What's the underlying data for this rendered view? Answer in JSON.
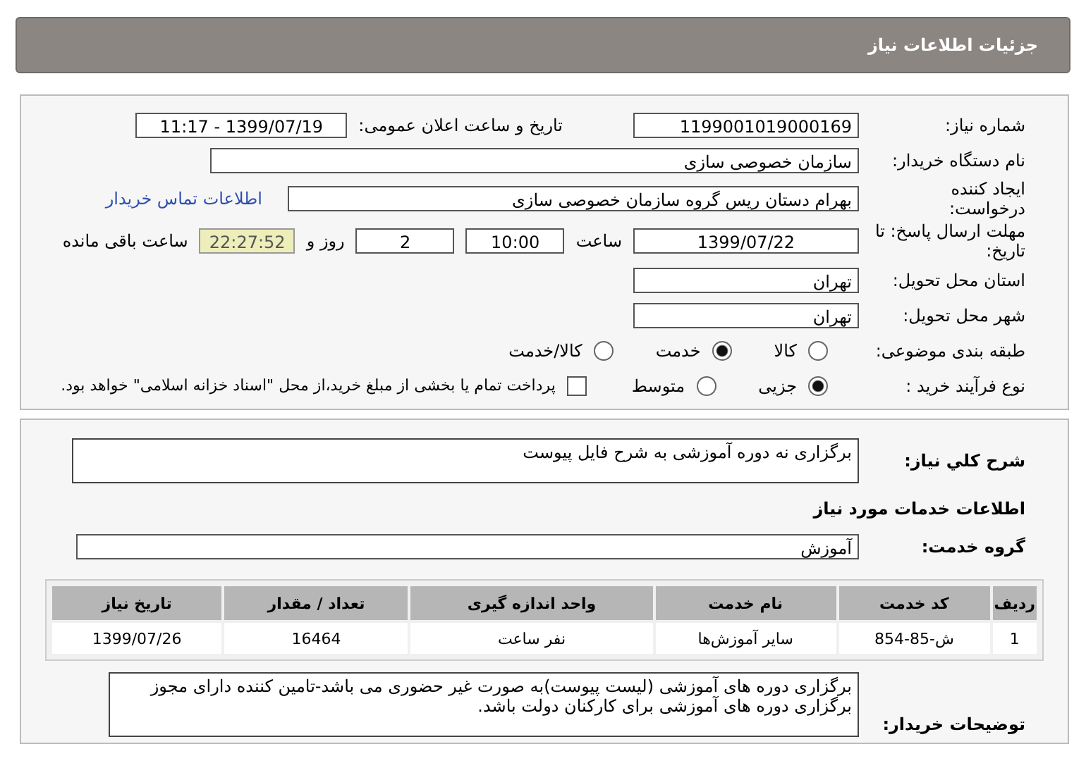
{
  "header": {
    "title": "جزئیات اطلاعات نیاز"
  },
  "need_number": {
    "label": "شماره نیاز:",
    "value": "1199001019000169"
  },
  "announce": {
    "label": "تاریخ و ساعت اعلان عمومی:",
    "value": "1399/07/19 - 11:17"
  },
  "buyer_org": {
    "label": "نام دستگاه خریدار:",
    "value": "سازمان خصوصی سازی"
  },
  "creator": {
    "label": "ایجاد کننده درخواست:",
    "value": "بهرام دستان ریس گروه سازمان خصوصی سازی",
    "link": "اطلاعات تماس خریدار"
  },
  "deadline": {
    "label": "مهلت ارسال پاسخ: تا تاریخ:",
    "date": "1399/07/22",
    "time_label": "ساعت",
    "time": "10:00",
    "days": "2",
    "days_label": "روز و",
    "remaining": "22:27:52",
    "remaining_label": "ساعت باقی مانده"
  },
  "province": {
    "label": "استان محل تحویل:",
    "value": "تهران"
  },
  "city": {
    "label": "شهر محل تحویل:",
    "value": "تهران"
  },
  "category": {
    "label": "طبقه بندی موضوعی:",
    "options": [
      {
        "label": "کالا",
        "selected": false
      },
      {
        "label": "خدمت",
        "selected": true
      },
      {
        "label": "کالا/خدمت",
        "selected": false
      }
    ]
  },
  "process": {
    "label": "نوع فرآیند خرید :",
    "options": [
      {
        "label": "جزیی",
        "selected": true
      },
      {
        "label": "متوسط",
        "selected": false
      }
    ],
    "payment": {
      "label": "پرداخت تمام یا بخشی از مبلغ خرید،از محل \"اسناد خزانه اسلامی\" خواهد بود.",
      "checked": false
    }
  },
  "summary": {
    "label": "شرح کلي نیاز:",
    "value": "برگزاری نه دوره آموزشی به شرح فایل پیوست"
  },
  "services_heading": "اطلاعات خدمات مورد نیاز",
  "service_group": {
    "label": "گروه خدمت:",
    "value": "آموزش"
  },
  "table": {
    "columns": [
      "ردیف",
      "کد خدمت",
      "نام خدمت",
      "واحد اندازه گیری",
      "تعداد / مقدار",
      "تاریخ نیاز"
    ],
    "rows": [
      [
        "1",
        "ش-85-854",
        "سایر آموزش‌ها",
        "نفر ساعت",
        "16464",
        "1399/07/26"
      ]
    ]
  },
  "buyer_notes": {
    "label": "توضیحات خریدار:",
    "value": "برگزاری دوره های آموزشی (لیست پیوست)به صورت غیر حضوری می باشد-تامین کننده دارای مجوز برگزاری دوره های آموزشی برای کارکنان دولت باشد."
  }
}
